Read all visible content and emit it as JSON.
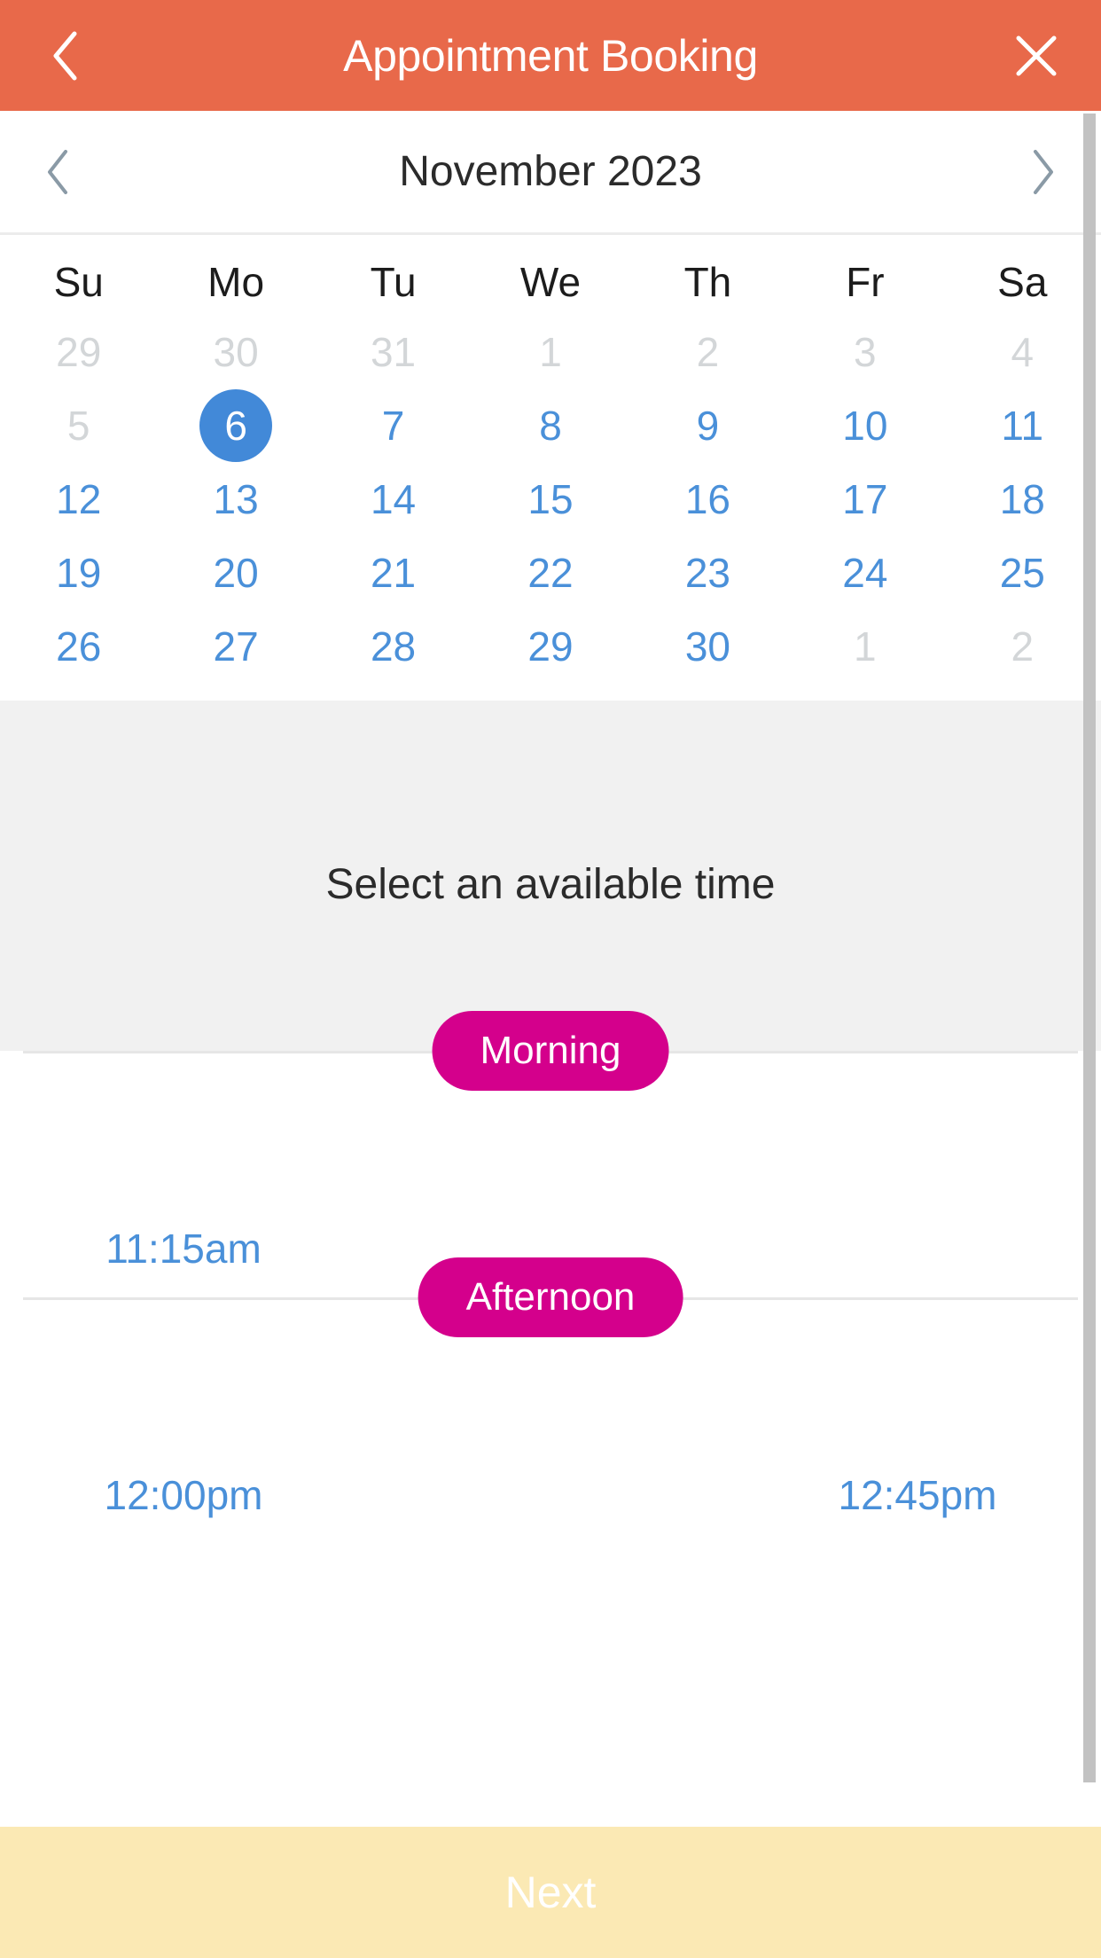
{
  "appbar": {
    "title": "Appointment Booking",
    "back_icon": "chevron-left-icon",
    "close_icon": "close-icon",
    "background_color": "#e8694a",
    "text_color": "#ffffff"
  },
  "calendar": {
    "month_label": "November 2023",
    "prev_icon": "chevron-left-icon",
    "next_icon": "chevron-right-icon",
    "weekdays": [
      "Su",
      "Mo",
      "Tu",
      "We",
      "Th",
      "Fr",
      "Sa"
    ],
    "selected_day": "6",
    "selected_color": "#4289d8",
    "enabled_color": "#4a90d9",
    "disabled_color": "#d3d6d8",
    "weeks": [
      [
        {
          "label": "29",
          "state": "disabled"
        },
        {
          "label": "30",
          "state": "disabled"
        },
        {
          "label": "31",
          "state": "disabled"
        },
        {
          "label": "1",
          "state": "disabled"
        },
        {
          "label": "2",
          "state": "disabled"
        },
        {
          "label": "3",
          "state": "disabled"
        },
        {
          "label": "4",
          "state": "disabled"
        }
      ],
      [
        {
          "label": "5",
          "state": "disabled"
        },
        {
          "label": "6",
          "state": "selected"
        },
        {
          "label": "7",
          "state": "enabled"
        },
        {
          "label": "8",
          "state": "enabled"
        },
        {
          "label": "9",
          "state": "enabled"
        },
        {
          "label": "10",
          "state": "enabled"
        },
        {
          "label": "11",
          "state": "enabled"
        }
      ],
      [
        {
          "label": "12",
          "state": "enabled"
        },
        {
          "label": "13",
          "state": "enabled"
        },
        {
          "label": "14",
          "state": "enabled"
        },
        {
          "label": "15",
          "state": "enabled"
        },
        {
          "label": "16",
          "state": "enabled"
        },
        {
          "label": "17",
          "state": "enabled"
        },
        {
          "label": "18",
          "state": "enabled"
        }
      ],
      [
        {
          "label": "19",
          "state": "enabled"
        },
        {
          "label": "20",
          "state": "enabled"
        },
        {
          "label": "21",
          "state": "enabled"
        },
        {
          "label": "22",
          "state": "enabled"
        },
        {
          "label": "23",
          "state": "enabled"
        },
        {
          "label": "24",
          "state": "enabled"
        },
        {
          "label": "25",
          "state": "enabled"
        }
      ],
      [
        {
          "label": "26",
          "state": "enabled"
        },
        {
          "label": "27",
          "state": "enabled"
        },
        {
          "label": "28",
          "state": "enabled"
        },
        {
          "label": "29",
          "state": "enabled"
        },
        {
          "label": "30",
          "state": "enabled"
        },
        {
          "label": "1",
          "state": "disabled"
        },
        {
          "label": "2",
          "state": "disabled"
        }
      ]
    ]
  },
  "time_panel": {
    "title": "Select an available time",
    "pill_color": "#d4008c",
    "periods": [
      {
        "label": "Morning",
        "slots": [
          "11:15am"
        ]
      },
      {
        "label": "Afternoon",
        "slots": [
          "12:00pm",
          "12:45pm"
        ]
      }
    ]
  },
  "footer": {
    "next_label": "Next",
    "next_background": "#fbe9b4",
    "next_text_color": "#ffffff"
  }
}
